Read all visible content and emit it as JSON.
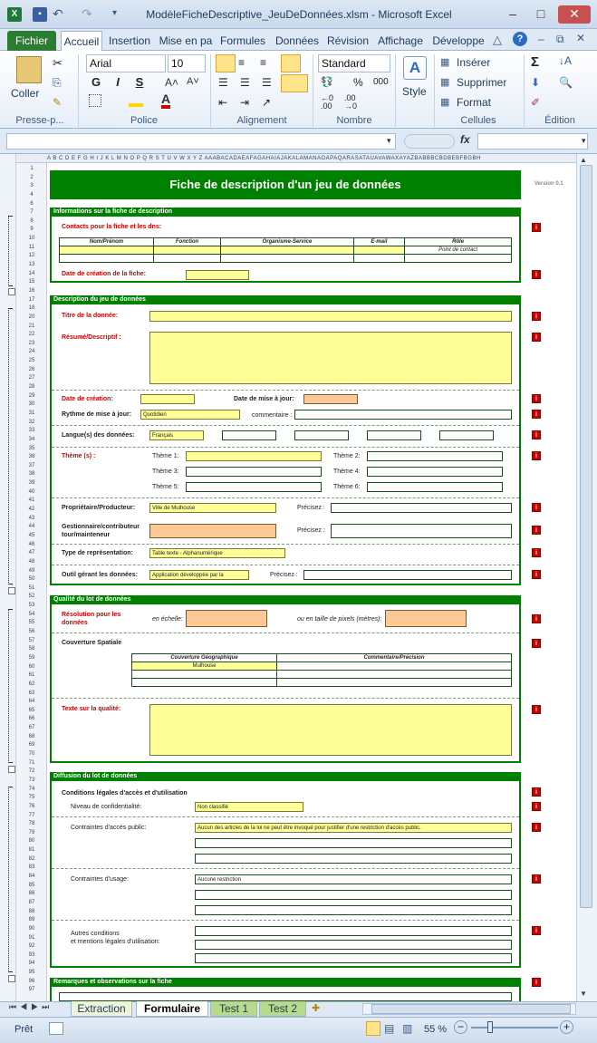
{
  "window": {
    "title": "ModèleFicheDescriptive_JeuDeDonnées.xlsm  -  Microsoft Excel",
    "app_icon": "excel-icon",
    "min": "‒",
    "max": "□",
    "close": "✕"
  },
  "ribbon": {
    "file_tab": "Fichier",
    "tabs": [
      "Accueil",
      "Insertion",
      "Mise en pa",
      "Formules",
      "Données",
      "Révision",
      "Affichage",
      "Développe"
    ],
    "paste_label": "Coller",
    "font_name": "Arial",
    "font_size": "10",
    "number_format": "Standard",
    "style_label": "Style",
    "insert_label": "Insérer",
    "delete_label": "Supprimer",
    "format_label": "Format",
    "bold": "G",
    "italic": "I",
    "underline": "S",
    "groups": [
      "Presse-p...",
      "Police",
      "Alignement",
      "Nombre",
      "Cellules",
      "Édition"
    ]
  },
  "formula_bar": {
    "fx": "fx"
  },
  "sheet": {
    "title": "Fiche de description d'un jeu de données",
    "version": "Version 0.1",
    "s1": {
      "head": "Informations sur la fiche de description",
      "contacts": "Contacts pour la fiche et les dns:",
      "cols": [
        "Nom/Prénom",
        "Fonction",
        "Organisme-Service",
        "E-mail",
        "Rôle"
      ],
      "role": "Point de contact",
      "date": "Date de création de la fiche:"
    },
    "s2": {
      "head": "Description du jeu de données",
      "titre": "Titre de la donnée:",
      "resume": "Résumé/Descriptif :",
      "creation": "Date de création:",
      "maj": "Date de mise à jour:",
      "rythme": "Rythme de mise à jour:",
      "rythme_val": "Quotidien",
      "commentaire": "commentaire :",
      "langue": "Langue(s) des données:",
      "langue_val": "Français",
      "theme": "Thème (s) :",
      "themes": [
        "Thème 1:",
        "Thème 2:",
        "Thème 3:",
        "Thème 4:",
        "Thème 5:",
        "Thème 6:"
      ],
      "proprio": "Propriétaire/Producteur:",
      "proprio_val": "Ville de Mulhouse",
      "precisez": "Précisez :",
      "gestion1": "Gestionnaire/contributeur",
      "gestion2": "tour/mainteneur",
      "type": "Type de représentation:",
      "type_val": "Table texte - Alphanumérique",
      "outil": "Outil gérant les données:",
      "outil_val": "Application développée par la"
    },
    "s3": {
      "head": "Qualité du lot de données",
      "resolution1": "Résolution pour les",
      "resolution2": "données",
      "echelle": "en échelle:",
      "pixel": "ou en taille de pixels (mètres):",
      "couverture": "Couverture Spatiale",
      "cols": [
        "Couverture Géographique",
        "Commentaire/Précision"
      ],
      "geo": "Mulhouse",
      "texte": "Texte sur la qualité:"
    },
    "s4": {
      "head": "Diffusion du lot de données",
      "conditions": "Conditions légales d'accès et d'utilisation",
      "niveau": "Niveau de confidentialité:",
      "niveau_val": "Non classifié",
      "contraintes_acces": "Contraintes d'accès public:",
      "acces_val": "Aucun des articles de la loi ne peut être invoqué pour justifier d'une restriction d'accès public.",
      "contraintes_usage": "Contraintes d'usage:",
      "usage_val": "Aucune restriction",
      "autres1": "Autres conditions",
      "autres2": "et mentions légales d'utilisation:"
    },
    "s5": {
      "head": "Remarques et observations sur la fiche"
    },
    "rows": [
      "1",
      "2",
      "3",
      "4",
      "6",
      "7",
      "8",
      "9",
      "10",
      "11",
      "12",
      "13",
      "14",
      "15",
      "16",
      "17",
      "18",
      "20",
      "21",
      "22",
      "23",
      "24",
      "25",
      "26",
      "27",
      "28",
      "29",
      "30",
      "31",
      "32",
      "33",
      "34",
      "35",
      "36",
      "37",
      "38",
      "39",
      "40",
      "41",
      "42",
      "43",
      "44",
      "45",
      "46",
      "47",
      "48",
      "49",
      "50",
      "51",
      "52",
      "53",
      "54",
      "55",
      "56",
      "57",
      "58",
      "59",
      "60",
      "61",
      "62",
      "63",
      "64",
      "65",
      "66",
      "67",
      "68",
      "69",
      "70",
      "71",
      "72",
      "73",
      "74",
      "75",
      "76",
      "77",
      "78",
      "79",
      "80",
      "81",
      "82",
      "83",
      "84",
      "85",
      "86",
      "87",
      "88",
      "89",
      "90",
      "91",
      "92",
      "93",
      "94",
      "95",
      "96",
      "97"
    ],
    "col_letters": "A B C D E F G H I J K L M N O P Q R S T U V W X Y Z AAABACADAEAFAGAHAIAJAKALAMANAOAPAQARASATAUAVAWAXAYAZBABBBCBDBEBFBGBH"
  },
  "sheet_tabs": [
    "Extraction",
    "Formulaire",
    "Test 1",
    "Test 2"
  ],
  "status": {
    "ready": "Prêt",
    "zoom": "55 %",
    "minus": "−",
    "plus": "+"
  }
}
